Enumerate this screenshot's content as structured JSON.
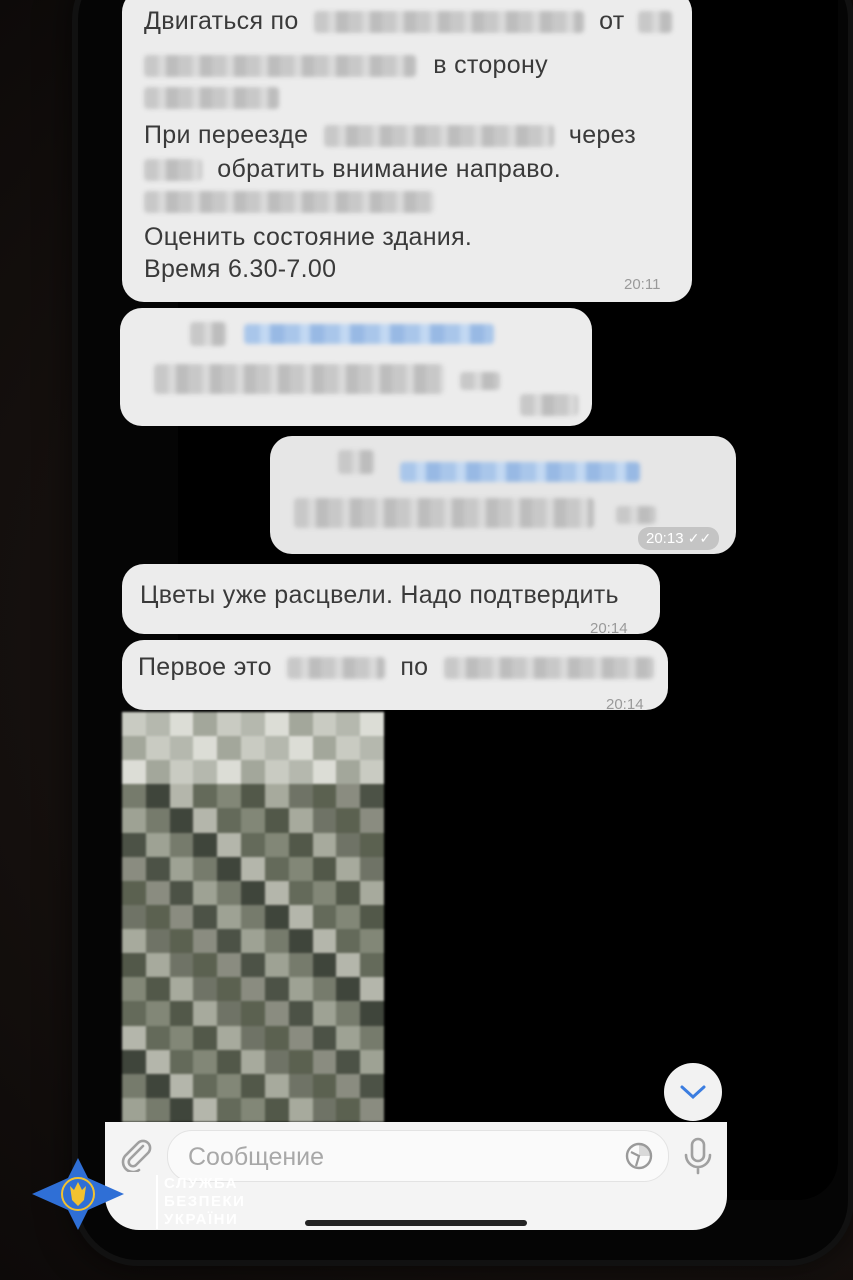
{
  "messages": {
    "m1": {
      "lines": [
        "Двигаться по",
        "от",
        "в сторону",
        "При переезде",
        "через",
        "обратить внимание направо.",
        "Оценить состояние здания.",
        "Время 6.30-7.00"
      ],
      "time": "20:11"
    },
    "m2": {
      "time": ""
    },
    "m3": {
      "time": "20:13",
      "status": "read"
    },
    "m4": {
      "text": "Цветы уже расцвели. Надо подтвердить",
      "time": "20:14"
    },
    "m5": {
      "prefix": "Первое это",
      "mid": "по",
      "time": "20:14"
    },
    "m6": {
      "type": "photo",
      "state": "pixelated"
    }
  },
  "input": {
    "placeholder": "Сообщение"
  },
  "icons": {
    "attach": "paperclip-icon",
    "sticker": "sticker-icon",
    "mic": "microphone-icon",
    "scroll": "chevron-down-icon"
  },
  "watermark": {
    "line1": "СЛУЖБА",
    "line2": "БЕЗПЕКИ",
    "line3": "УКРАЇНИ"
  },
  "colors": {
    "bubble": "#ececec",
    "accent": "#3b7de0",
    "logo_blue": "#2f6fd6",
    "logo_gold": "#f2c230"
  }
}
